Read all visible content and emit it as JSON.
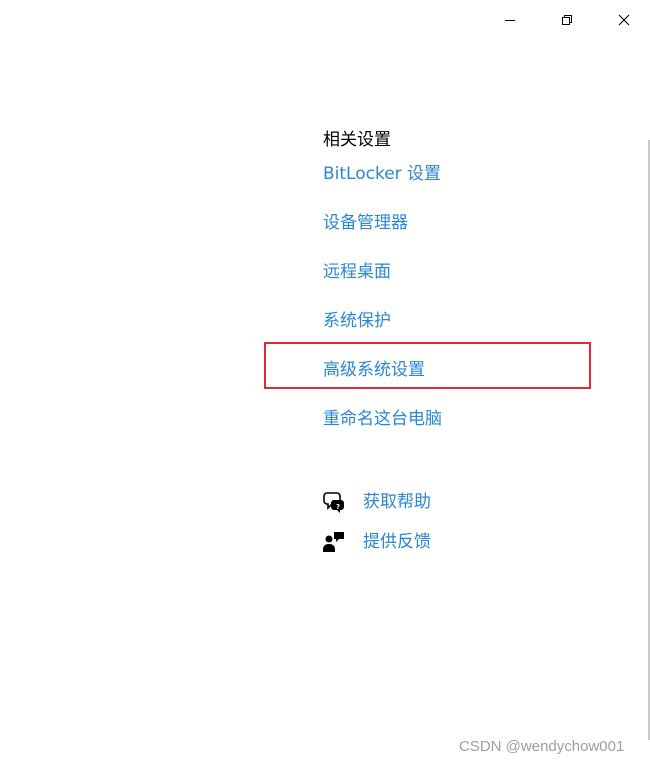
{
  "window": {
    "minimize_icon": "minimize-icon",
    "restore_icon": "restore-icon",
    "close_icon": "close-icon"
  },
  "related_settings": {
    "title": "相关设置",
    "links": [
      {
        "label": "BitLocker 设置"
      },
      {
        "label": "设备管理器"
      },
      {
        "label": "远程桌面"
      },
      {
        "label": "系统保护"
      },
      {
        "label": "高级系统设置"
      },
      {
        "label": "重命名这台电脑"
      }
    ]
  },
  "support": {
    "get_help": {
      "label": "获取帮助",
      "icon": "chat-help-icon"
    },
    "feedback": {
      "label": "提供反馈",
      "icon": "feedback-person-icon"
    }
  },
  "colors": {
    "link": "#2a86d6",
    "highlight": "#e02b35"
  },
  "watermark": "CSDN @wendychow001"
}
